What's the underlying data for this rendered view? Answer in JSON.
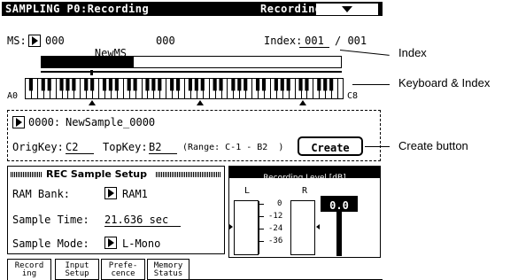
{
  "title": {
    "page": "SAMPLING P0:Recording",
    "mode": "Recording"
  },
  "multisample": {
    "label": "MS:",
    "number": "000",
    "name": "NewMS",
    "suffix": "000",
    "index_label": "Index:",
    "index_current": "001",
    "index_total": "/ 001"
  },
  "keyboard": {
    "low_label": "A0",
    "high_label": "C8"
  },
  "sample": {
    "number": "0000:",
    "name": "NewSample_0000",
    "origkey_label": "OrigKey:",
    "origkey_value": "C2",
    "topkey_label": "TopKey:",
    "topkey_value": "B2",
    "range_text": "(Range: C-1 - B2  )",
    "create_label": "Create"
  },
  "rec_setup": {
    "header": "REC Sample Setup",
    "ram_bank_label": "RAM Bank:",
    "ram_bank_value": "RAM1",
    "sample_time_label": "Sample Time:",
    "sample_time_value": "21.636 sec",
    "sample_mode_label": "Sample Mode:",
    "sample_mode_value": "L-Mono"
  },
  "level": {
    "header": "Recording Level [dB]",
    "left": "L",
    "right": "R",
    "marks": [
      "0",
      "-12",
      "-24",
      "-36"
    ],
    "value": "0.0"
  },
  "tabs": [
    {
      "line1": "Record",
      "line2": "ing"
    },
    {
      "line1": "Input",
      "line2": "Setup"
    },
    {
      "line1": "Prefe-",
      "line2": "cence"
    },
    {
      "line1": "Memory",
      "line2": "Status"
    }
  ],
  "callouts": {
    "index": "Index",
    "keyboard_index": "Keyboard & Index",
    "create_button": "Create button"
  },
  "colors": {
    "lcd_fg": "#000000",
    "lcd_bg": "#ffffff"
  }
}
